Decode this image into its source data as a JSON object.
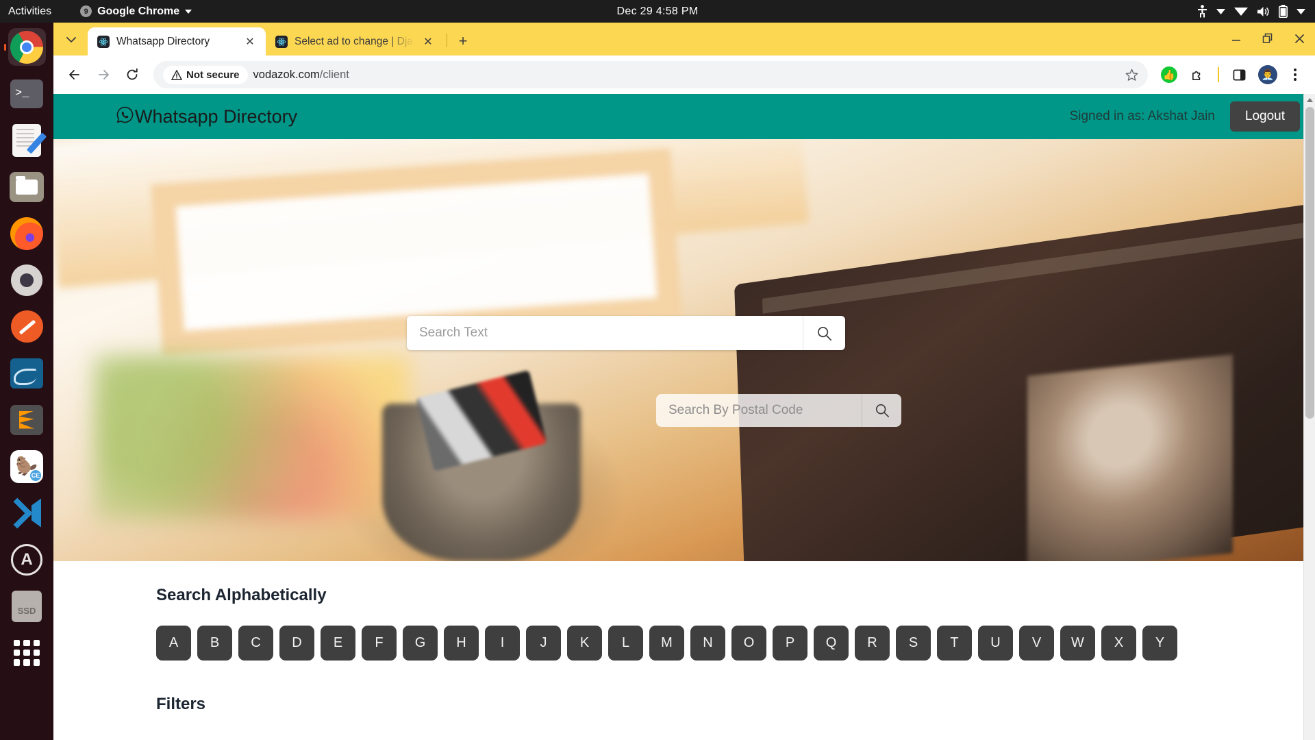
{
  "system": {
    "activities": "Activities",
    "app_menu": "Google Chrome",
    "app_badge": "9",
    "clock": "Dec 29  4:58 PM",
    "tray_icons": [
      "accessibility-icon",
      "chevron-down-icon",
      "wifi-icon",
      "volume-icon",
      "battery-icon",
      "chevron-down-icon"
    ]
  },
  "dock": {
    "items": [
      {
        "name": "google-chrome",
        "label": "Google Chrome",
        "running": true
      },
      {
        "name": "terminal",
        "label": "Terminal",
        "running": false
      },
      {
        "name": "text-editor",
        "label": "Text Editor",
        "running": false
      },
      {
        "name": "files",
        "label": "Files",
        "running": false
      },
      {
        "name": "firefox",
        "label": "Firefox",
        "running": false
      },
      {
        "name": "settings",
        "label": "Settings",
        "running": false
      },
      {
        "name": "postman",
        "label": "Postman",
        "running": false
      },
      {
        "name": "mysql-workbench",
        "label": "MySQL Workbench",
        "running": false
      },
      {
        "name": "sublime-text",
        "label": "Sublime Text",
        "running": false
      },
      {
        "name": "dbeaver",
        "label": "DBeaver CE",
        "running": false
      },
      {
        "name": "visual-studio-code",
        "label": "Visual Studio Code",
        "running": false
      },
      {
        "name": "ubuntu-software",
        "label": "Ubuntu Software",
        "running": false
      },
      {
        "name": "ssd-drive",
        "label": "SSD",
        "running": false
      },
      {
        "name": "show-applications",
        "label": "Show Applications",
        "running": false
      }
    ],
    "ssd_label": "SSD",
    "dbeaver_badge": "CE",
    "ubuntu_software_letter": "A"
  },
  "browser": {
    "tabs": [
      {
        "title": "Whatsapp Directory",
        "active": true
      },
      {
        "title": "Select ad to change | Dja",
        "active": false
      }
    ],
    "new_tab_label": "+",
    "close_label": "✕",
    "security_label": "Not secure",
    "url_domain": "vodazok.com",
    "url_path": "/client",
    "window_controls": [
      "minimize",
      "maximize",
      "close"
    ]
  },
  "page": {
    "brand": "Whatsapp Directory",
    "signed_in": "Signed in as: Akshat Jain",
    "logout": "Logout",
    "search_text_placeholder": "Search Text",
    "search_postal_placeholder": "Search By Postal Code",
    "search_text_value": "",
    "search_postal_value": "",
    "alphabetical_title": "Search Alphabetically",
    "letters": [
      "A",
      "B",
      "C",
      "D",
      "E",
      "F",
      "G",
      "H",
      "I",
      "J",
      "K",
      "L",
      "M",
      "N",
      "O",
      "P",
      "Q",
      "R",
      "S",
      "T",
      "U",
      "V",
      "W",
      "X",
      "Y"
    ],
    "filters_title": "Filters",
    "colors": {
      "navbar": "#009688",
      "logout_button": "#424242",
      "letter_button": "#3f3f3f",
      "tabstrip": "#fcd752"
    }
  }
}
